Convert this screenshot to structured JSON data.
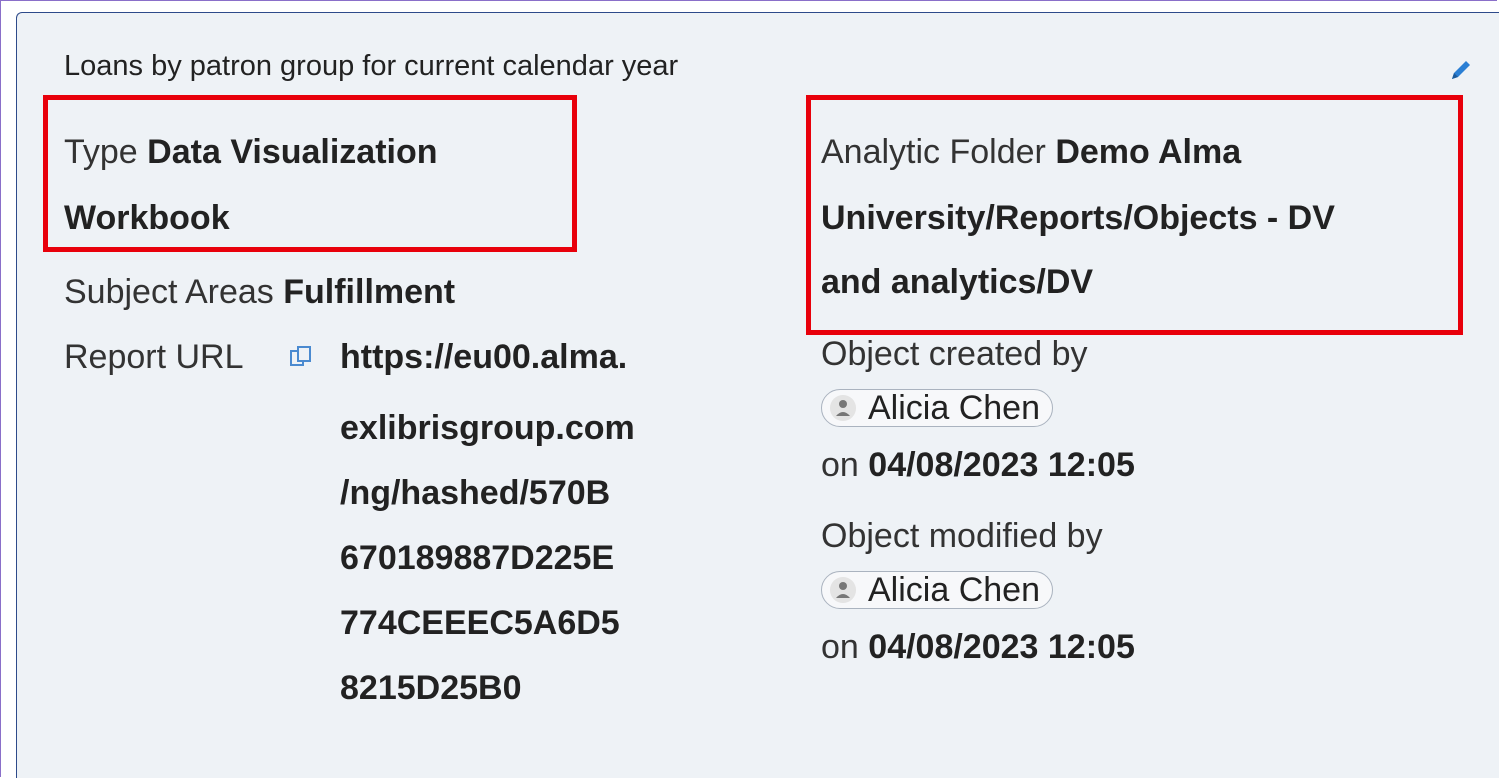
{
  "report": {
    "title": "Loans by patron group for current calendar year",
    "type_label": "Type",
    "type_value_line1": "Data Visualization",
    "type_value_line2": "Workbook",
    "subject_label": "Subject Areas",
    "subject_value": "Fulfillment",
    "url_label": "Report URL",
    "url_lines": [
      "https://eu00.alma.",
      "exlibrisgroup.com",
      "/ng/hashed/570B",
      "670189887D225E",
      "774CEEEC5A6D5",
      "8215D25B0"
    ],
    "folder_label": "Analytic Folder",
    "folder_line1": "Demo Alma",
    "folder_line2": "University/Reports/Objects - DV",
    "folder_line3": "and analytics/DV",
    "created_label": "Object created by",
    "created_user": "Alicia Chen",
    "created_on_label": "on",
    "created_on_value": "04/08/2023 12:05",
    "modified_label": "Object modified by",
    "modified_user": "Alicia Chen",
    "modified_on_label": "on",
    "modified_on_value": "04/08/2023 12:05"
  },
  "icons": {
    "edit": "pencil-icon",
    "copy": "copy-icon",
    "user": "user-icon"
  },
  "colors": {
    "highlight": "#e8000b",
    "card_background": "#eef2f6",
    "edit_icon": "#2a7fd4"
  }
}
